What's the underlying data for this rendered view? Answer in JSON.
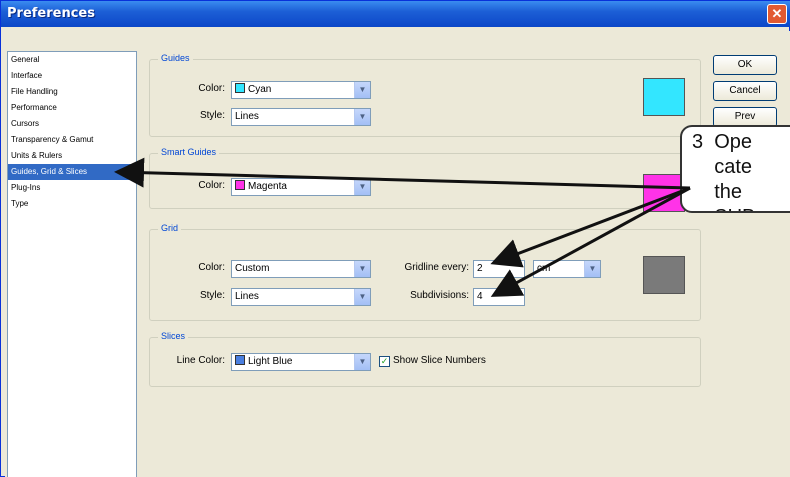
{
  "window": {
    "title": "Preferences",
    "close_glyph": "✕"
  },
  "sidebar": {
    "items": [
      {
        "label": "General"
      },
      {
        "label": "Interface"
      },
      {
        "label": "File Handling"
      },
      {
        "label": "Performance"
      },
      {
        "label": "Cursors"
      },
      {
        "label": "Transparency & Gamut"
      },
      {
        "label": "Units & Rulers"
      },
      {
        "label": "Guides, Grid & Slices",
        "selected": true
      },
      {
        "label": "Plug-Ins"
      },
      {
        "label": "Type"
      }
    ]
  },
  "guides": {
    "title": "Guides",
    "color_label": "Color:",
    "color_value": "Cyan",
    "color_hex": "#33e6ff",
    "style_label": "Style:",
    "style_value": "Lines"
  },
  "smart_guides": {
    "title": "Smart Guides",
    "color_label": "Color:",
    "color_value": "Magenta",
    "color_hex": "#ff33e8"
  },
  "grid": {
    "title": "Grid",
    "color_label": "Color:",
    "color_value": "Custom",
    "color_hex": "#7a7a7a",
    "style_label": "Style:",
    "style_value": "Lines",
    "gridline_label": "Gridline every:",
    "gridline_value": "2",
    "gridline_unit": "cm",
    "subdivisions_label": "Subdivisions:",
    "subdivisions_value": "4"
  },
  "slices": {
    "title": "Slices",
    "line_color_label": "Line Color:",
    "line_color_value": "Light Blue",
    "line_color_hex": "#4a7fe0",
    "show_numbers_label": "Show Slice Numbers",
    "show_numbers_checked": true
  },
  "buttons": {
    "ok": "OK",
    "cancel": "Cancel",
    "prev": "Prev"
  },
  "callout": {
    "line1": "3  Ope",
    "line2": "    cate",
    "line3": "    the",
    "line4": "    SUB"
  }
}
